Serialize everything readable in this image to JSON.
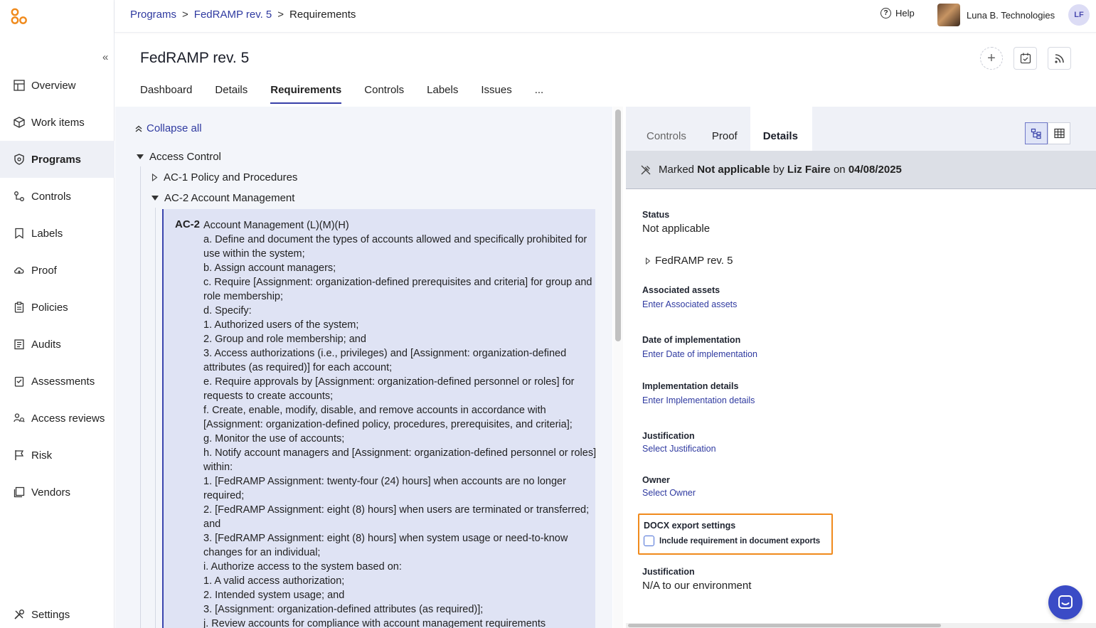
{
  "sidebar": {
    "collapse_icon": "«",
    "items": [
      {
        "label": "Overview",
        "icon": "overview-icon"
      },
      {
        "label": "Work items",
        "icon": "work-items-icon"
      },
      {
        "label": "Programs",
        "icon": "programs-icon",
        "active": true
      },
      {
        "label": "Controls",
        "icon": "controls-icon"
      },
      {
        "label": "Labels",
        "icon": "labels-icon"
      },
      {
        "label": "Proof",
        "icon": "proof-icon"
      },
      {
        "label": "Policies",
        "icon": "policies-icon"
      },
      {
        "label": "Audits",
        "icon": "audits-icon"
      },
      {
        "label": "Assessments",
        "icon": "assessments-icon"
      },
      {
        "label": "Access reviews",
        "icon": "access-reviews-icon"
      },
      {
        "label": "Risk",
        "icon": "risk-icon"
      },
      {
        "label": "Vendors",
        "icon": "vendors-icon"
      }
    ],
    "settings_label": "Settings"
  },
  "header": {
    "breadcrumb": [
      "Programs",
      "FedRAMP rev. 5",
      "Requirements"
    ],
    "breadcrumb_sep": ">",
    "help_label": "Help",
    "org_name": "Luna B. Technologies",
    "user_initials": "LF"
  },
  "page": {
    "title": "FedRAMP rev. 5",
    "tabs": [
      "Dashboard",
      "Details",
      "Requirements",
      "Controls",
      "Labels",
      "Issues",
      "..."
    ],
    "active_tab": "Requirements"
  },
  "tree": {
    "collapse_all": "Collapse all",
    "root": "Access Control",
    "children": [
      "AC-1 Policy and Procedures",
      "AC-2 Account Management"
    ],
    "requirement": {
      "code": "AC-2",
      "lines": [
        "Account Management (L)(M)(H)",
        "a. Define and document the types of accounts allowed and specifically prohibited for use within the system;",
        "b. Assign account managers;",
        "c. Require [Assignment: organization-defined prerequisites and criteria] for group and role membership;",
        "d. Specify:",
        "1. Authorized users of the system;",
        "2. Group and role membership; and",
        "3. Access authorizations (i.e., privileges) and [Assignment: organization-defined attributes (as required)] for each account;",
        "e. Require approvals by [Assignment: organization-defined personnel or roles] for requests to create accounts;",
        "f. Create, enable, modify, disable, and remove accounts in accordance with [Assignment: organization-defined policy, procedures, prerequisites, and criteria];",
        "g. Monitor the use of accounts;",
        "h. Notify account managers and [Assignment: organization-defined personnel or roles] within:",
        "1. [FedRAMP Assignment: twenty-four (24) hours] when accounts are no longer required;",
        "2. [FedRAMP Assignment: eight (8) hours] when users are terminated or transferred; and",
        "3. [FedRAMP Assignment: eight (8) hours] when system usage or need-to-know changes for an individual;",
        "i. Authorize access to the system based on:",
        "1. A valid access authorization;",
        "2. Intended system usage; and",
        "3. [Assignment: organization-defined attributes (as required)];",
        "j. Review accounts for compliance with account management requirements"
      ]
    }
  },
  "details": {
    "tabs": [
      "Controls",
      "Proof",
      "Details"
    ],
    "active_tab": "Details",
    "banner": {
      "prefix": "Marked",
      "status": "Not applicable",
      "by": "by",
      "user": "Liz Faire",
      "on": "on",
      "date": "04/08/2025"
    },
    "status_label": "Status",
    "status_value": "Not applicable",
    "framework": "FedRAMP rev. 5",
    "assets_label": "Associated assets",
    "assets_link": "Enter Associated assets",
    "date_label": "Date of implementation",
    "date_link": "Enter Date of implementation",
    "impl_label": "Implementation details",
    "impl_link": "Enter Implementation details",
    "justification_label": "Justification",
    "justification_link": "Select Justification",
    "owner_label": "Owner",
    "owner_link": "Select Owner",
    "docx_label": "DOCX export settings",
    "docx_checkbox": "Include requirement in document exports",
    "docx_checked": false,
    "justification2_label": "Justification",
    "justification2_value": "N/A to our environment"
  },
  "colors": {
    "accent": "#3740a8",
    "link": "#2f3aa0",
    "highlight": "#f08a1c",
    "requirement_bg": "#dfe3f4",
    "logo": "#f08a1c"
  }
}
